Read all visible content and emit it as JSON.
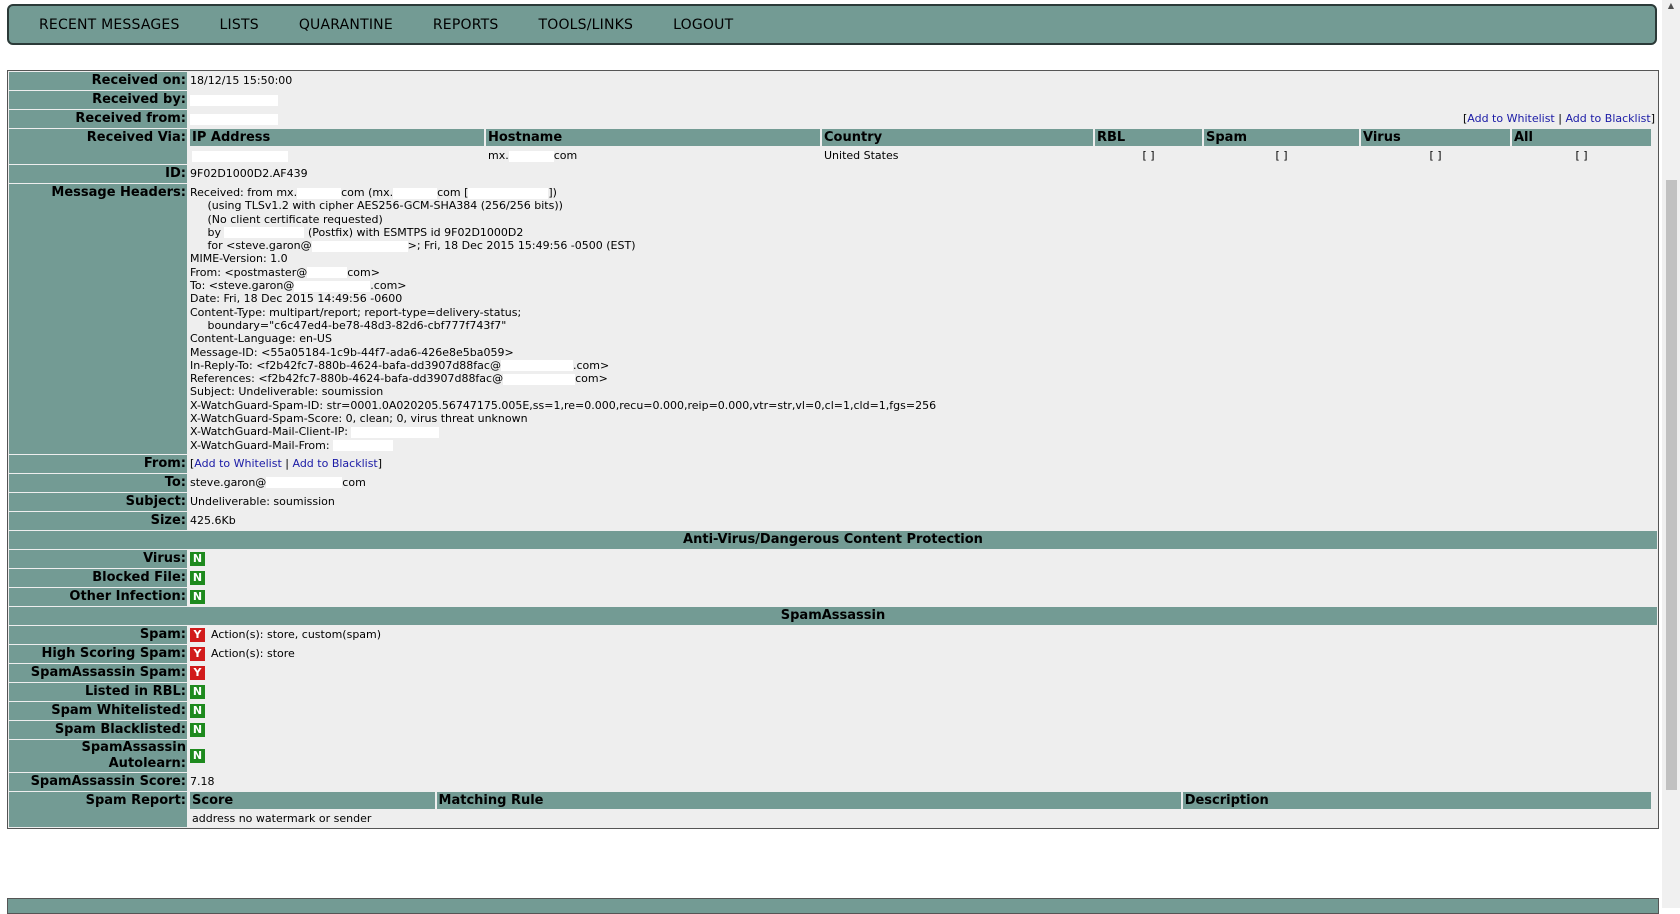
{
  "nav": [
    "RECENT MESSAGES",
    "LISTS",
    "QUARANTINE",
    "REPORTS",
    "TOOLS/LINKS",
    "LOGOUT"
  ],
  "labels": {
    "received_on": "Received on:",
    "received_by": "Received by:",
    "received_from": "Received from:",
    "received_via": "Received Via:",
    "id": "ID:",
    "message_headers": "Message Headers:",
    "from": "From:",
    "to": "To:",
    "subject": "Subject:",
    "size": "Size:"
  },
  "values": {
    "received_on": "18/12/15 15:50:00",
    "id": "9F02D1000D2.AF439",
    "to_prefix": "steve.garon@",
    "to_suffix": "com",
    "subject": "Undeliverable: soumission",
    "size": "425.6Kb"
  },
  "links": {
    "open": "[",
    "whitelist": "Add to Whitelist",
    "sep": " | ",
    "blacklist": "Add to Blacklist",
    "close": "]"
  },
  "via": {
    "headers": [
      "IP Address",
      "Hostname",
      "Country",
      "RBL",
      "Spam",
      "Virus",
      "All"
    ],
    "row": {
      "hostname_prefix": "mx.",
      "hostname_suffix": "com",
      "country": "United States",
      "rbl": "[ ]",
      "spam": "[ ]",
      "virus": "[ ]",
      "all": "[ ]"
    }
  },
  "headers": {
    "l1a": "Received: from mx.",
    "l1b": "com (mx.",
    "l1c": "com [",
    "l1d": "])",
    "l2": "     (using TLSv1.2 with cipher AES256-GCM-SHA384 (256/256 bits))",
    "l3": "     (No client certificate requested)",
    "l4a": "     by ",
    "l4b": " (Postfix) with ESMTPS id 9F02D1000D2",
    "l5a": "     for <steve.garon@",
    "l5b": ">; Fri, 18 Dec 2015 15:49:56 -0500 (EST)",
    "l6": "MIME-Version: 1.0",
    "l7a": "From: <postmaster@",
    "l7b": "com>",
    "l8a": "To: <steve.garon@",
    "l8b": ".com>",
    "l9": "Date: Fri, 18 Dec 2015 14:49:56 -0600",
    "l10": "Content-Type: multipart/report; report-type=delivery-status;",
    "l11": "     boundary=\"c6c47ed4-be78-48d3-82d6-cbf777f743f7\"",
    "l12": "Content-Language: en-US",
    "l13": "Message-ID: <55a05184-1c9b-44f7-ada6-426e8e5ba059>",
    "l14a": "In-Reply-To: <f2b42fc7-880b-4624-bafa-dd3907d88fac@",
    "l14b": ".com>",
    "l15a": "References: <f2b42fc7-880b-4624-bafa-dd3907d88fac@",
    "l15b": "com>",
    "l16": "Subject: Undeliverable: soumission",
    "l17": "X-WatchGuard-Spam-ID: str=0001.0A020205.56747175.005E,ss=1,re=0.000,recu=0.000,reip=0.000,vtr=str,vl=0,cl=1,cld=1,fgs=256",
    "l18": "X-WatchGuard-Spam-Score: 0, clean; 0, virus threat unknown",
    "l19": "X-WatchGuard-Mail-Client-IP: ",
    "l20": "X-WatchGuard-Mail-From: "
  },
  "av": {
    "title": "Anti-Virus/Dangerous Content Protection",
    "rows": [
      {
        "label": "Virus:",
        "badge": "N"
      },
      {
        "label": "Blocked File:",
        "badge": "N"
      },
      {
        "label": "Other Infection:",
        "badge": "N"
      }
    ]
  },
  "sa": {
    "title": "SpamAssassin",
    "rows": [
      {
        "label": "Spam:",
        "badge": "Y",
        "text": "Action(s): store, custom(spam)"
      },
      {
        "label": "High Scoring Spam:",
        "badge": "Y",
        "text": "Action(s): store"
      },
      {
        "label": "SpamAssassin Spam:",
        "badge": "Y",
        "text": ""
      },
      {
        "label": "Listed in RBL:",
        "badge": "N",
        "text": ""
      },
      {
        "label": "Spam Whitelisted:",
        "badge": "N",
        "text": ""
      },
      {
        "label": "Spam Blacklisted:",
        "badge": "N",
        "text": ""
      },
      {
        "label": "SpamAssassin Autolearn:",
        "badge": "N",
        "text": ""
      }
    ],
    "score_label": "SpamAssassin Score:",
    "score": "7.18",
    "report_label": "Spam Report:",
    "report_headers": [
      "Score",
      "Matching Rule",
      "Description"
    ],
    "report_row": "address no watermark or sender"
  },
  "colors": {
    "header_bg": "#739b94",
    "yes_badge": "#d11b1b",
    "no_badge": "#1e8a1e",
    "link": "#1a1aa6"
  }
}
